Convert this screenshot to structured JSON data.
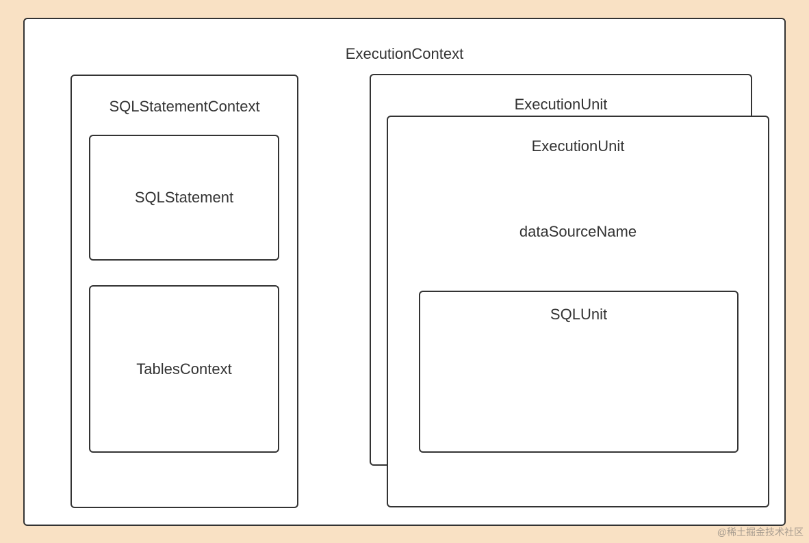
{
  "diagram": {
    "outer": {
      "title": "ExecutionContext"
    },
    "sqlStatementContext": {
      "title": "SQLStatementContext",
      "sqlStatement": "SQLStatement",
      "tablesContext": "TablesContext"
    },
    "executionUnit": {
      "backTitle": "ExecutionUnit",
      "frontTitle": "ExecutionUnit",
      "dataSourceName": "dataSourceName",
      "sqlUnit": "SQLUnit"
    }
  },
  "watermark": "@稀土掘金技术社区"
}
